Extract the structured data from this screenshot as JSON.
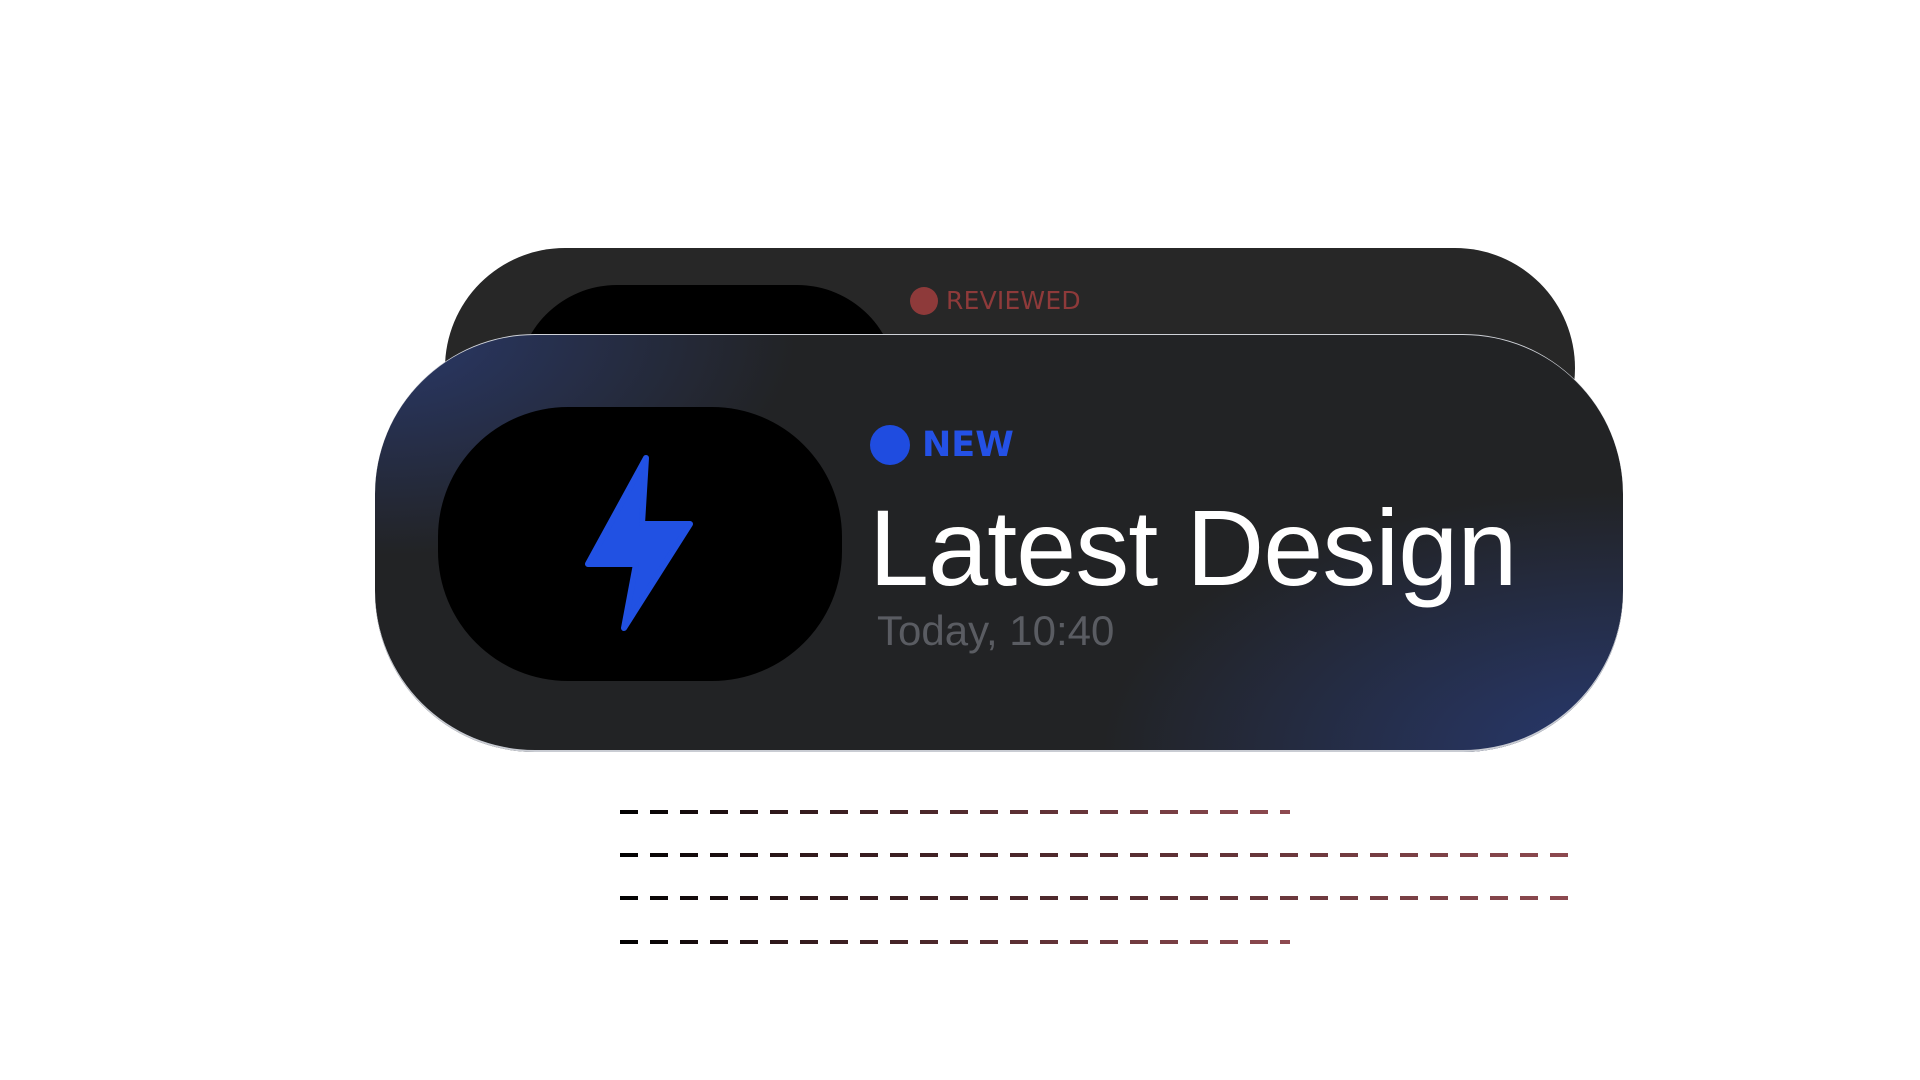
{
  "back_notification": {
    "badge_label": "REVIEWED",
    "badge_color": "#8e3a3a"
  },
  "front_notification": {
    "badge_label": "NEW",
    "badge_color": "#1f4ce0",
    "title": "Latest Design",
    "timestamp": "Today, 10:40",
    "icon": "lightning-bolt-icon"
  },
  "colors": {
    "card_dark": "#222325",
    "card_accent": "#2a3a6e",
    "trail": "#8e4a50"
  }
}
